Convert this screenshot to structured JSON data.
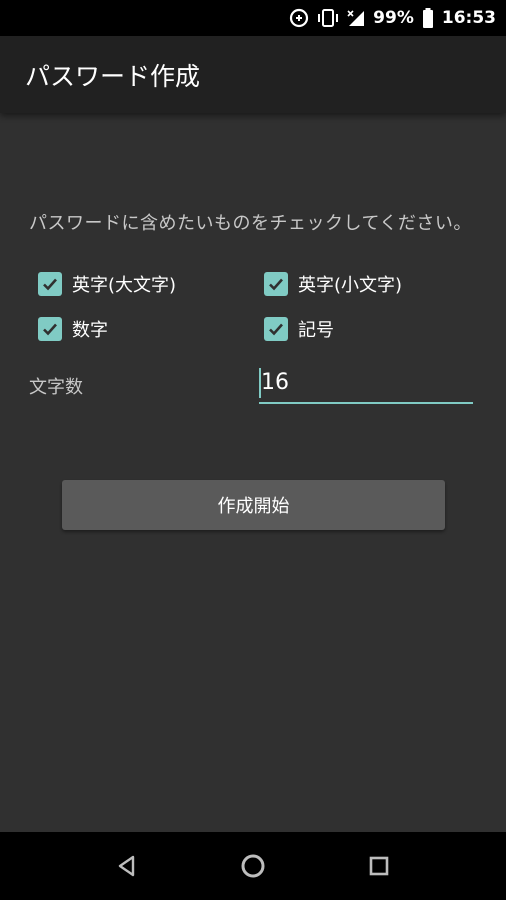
{
  "status_bar": {
    "battery_percent": "99%",
    "time": "16:53",
    "icons": [
      "data-saver-icon",
      "vibrate-icon",
      "no-signal-icon",
      "battery-icon"
    ]
  },
  "app_bar": {
    "title": "パスワード作成"
  },
  "instruction": "パスワードに含めたいものをチェックしてください。",
  "options": [
    {
      "label": "英字(大文字)",
      "checked": true
    },
    {
      "label": "英字(小文字)",
      "checked": true
    },
    {
      "label": "数字",
      "checked": true
    },
    {
      "label": "記号",
      "checked": true
    }
  ],
  "length": {
    "label": "文字数",
    "value": "16"
  },
  "start_button": {
    "label": "作成開始"
  },
  "nav_bar": {
    "icons": [
      "back-icon",
      "home-icon",
      "recents-icon"
    ]
  },
  "colors": {
    "accent": "#80cbc4",
    "background": "#303030",
    "app_bar": "#212121",
    "button": "#5a5a5a"
  }
}
